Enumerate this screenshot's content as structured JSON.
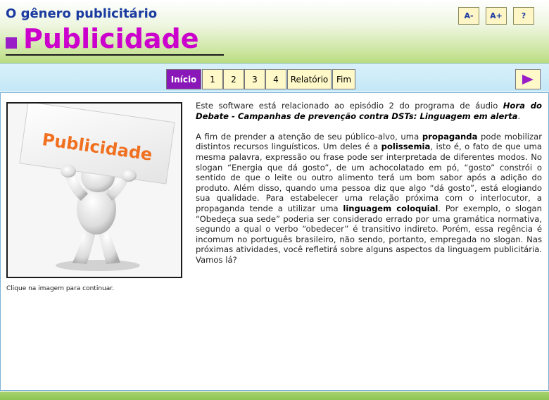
{
  "header": {
    "subtitle": "O gênero publicitário",
    "title": "Publicidade",
    "font_buttons": [
      "A-",
      "A+",
      "?"
    ]
  },
  "nav": {
    "items": [
      "Início",
      "1",
      "2",
      "3",
      "4",
      "Relatório",
      "Fim"
    ],
    "active_index": 0,
    "next_icon": "play-arrow-icon"
  },
  "image": {
    "sign_text": "Publicidade",
    "caption": "Clique na imagem para continuar."
  },
  "body": {
    "p1": {
      "before": "Este software está relacionado ao episódio 2 do programa de áudio ",
      "emph": "Hora do Debate - Campanhas de prevenção contra DSTs: Linguagem em alerta",
      "after": "."
    },
    "p2": {
      "s1": "A fim de prender a atenção de seu público-alvo, uma ",
      "b1": "propaganda",
      "s2": " pode mobilizar distintos recursos linguísticos. Um deles é a ",
      "b2": "polissemia",
      "s3": ", isto é, o fato de que uma mesma palavra, expressão ou frase pode ser interpretada de diferentes modos. No slogan “Energia que dá gosto”, de um achocolatado em pó, “gosto” constrói o sentido de que o leite ou outro alimento terá um bom sabor após a adição do produto. Além disso, quando uma pessoa diz que algo “dá gosto”, está elogiando sua qualidade. Para estabelecer uma relação próxima com o interlocutor, a propaganda tende a utilizar uma ",
      "b3": "linguagem coloquial",
      "s4": ". Por exemplo, o slogan “Obedeça sua sede” poderia ser considerado errado por uma gramática normativa, segundo a qual o verbo “obedecer” é transitivo indireto. Porém, essa regência é incomum no português brasileiro, não sendo, portanto, empregada no slogan. Nas próximas atividades, você refletirá sobre alguns aspectos da linguagem publicitária. Vamos lá?"
    }
  },
  "colors": {
    "title": "#cc00cc",
    "subtitle": "#1a3aa0",
    "active_nav": "#8a18b8",
    "sign_text": "#f07020"
  }
}
